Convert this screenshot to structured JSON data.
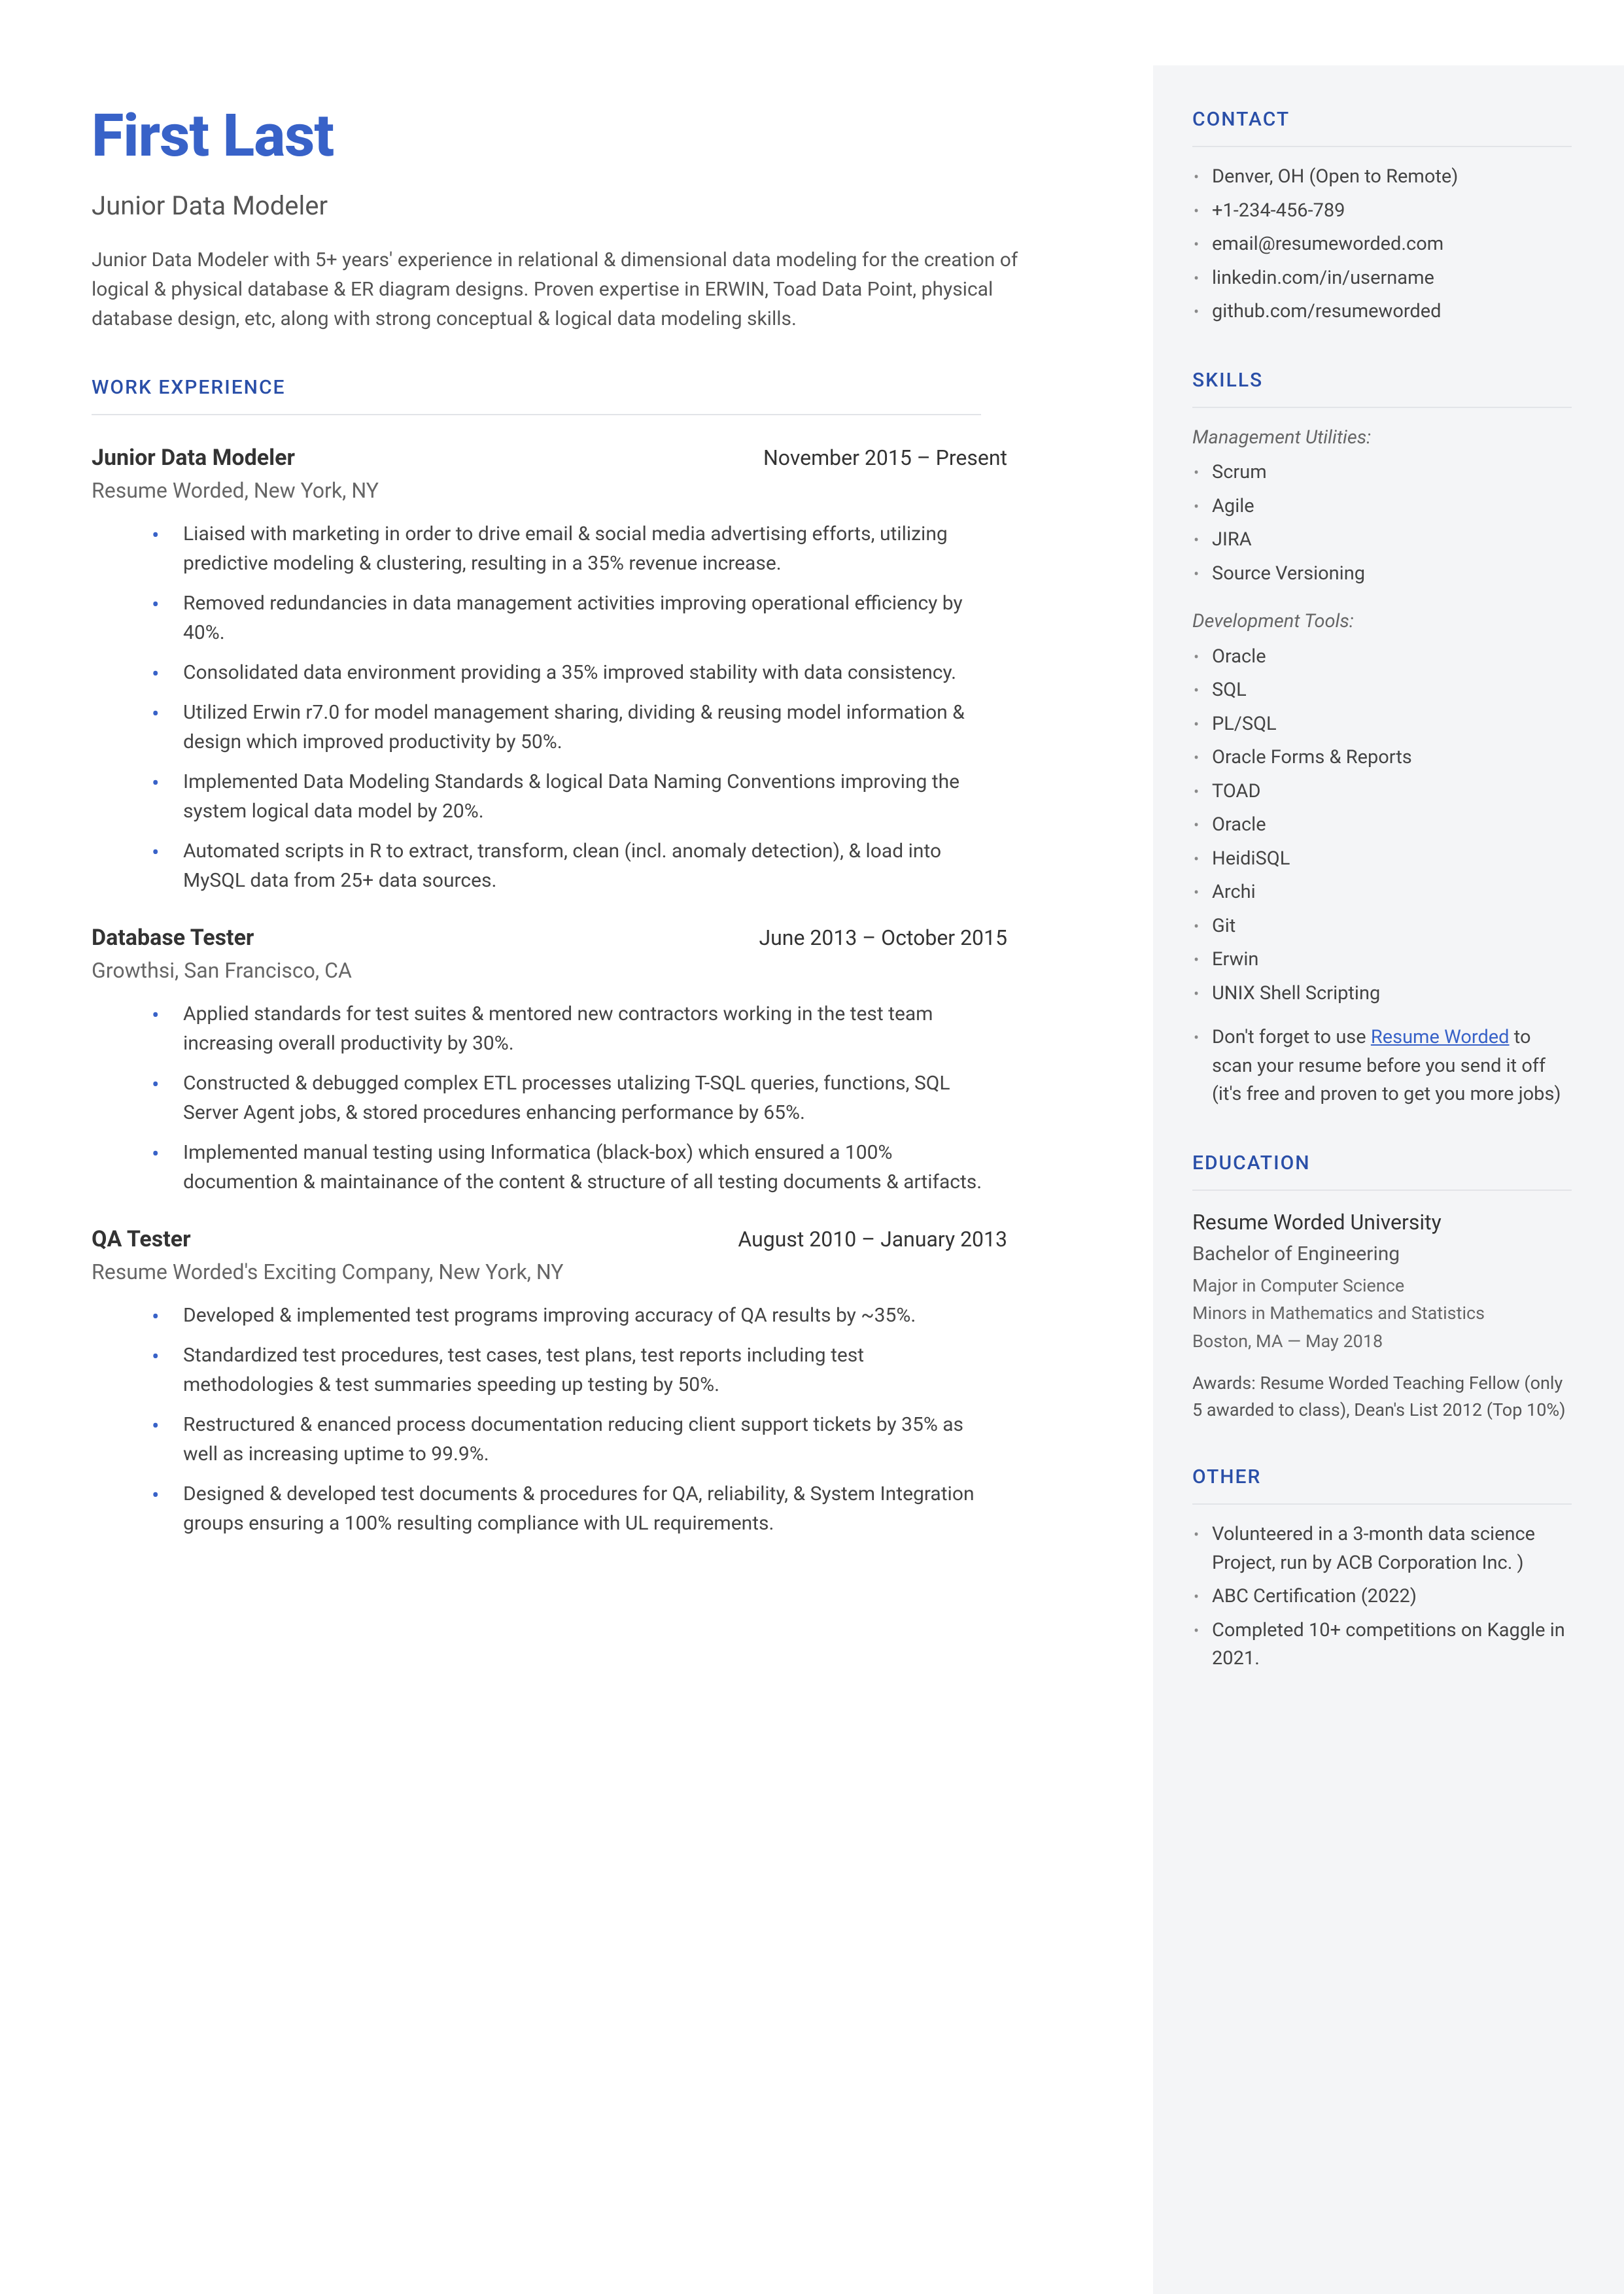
{
  "header": {
    "name": "First Last",
    "title": "Junior Data Modeler",
    "summary": "Junior Data Modeler with 5+ years' experience in relational & dimensional data modeling for the creation of logical & physical database & ER diagram designs. Proven expertise in ERWIN, Toad Data Point, physical database design, etc, along with strong conceptual & logical data modeling skills."
  },
  "sections": {
    "work_experience_heading": "WORK EXPERIENCE",
    "contact_heading": "CONTACT",
    "skills_heading": "SKILLS",
    "education_heading": "EDUCATION",
    "other_heading": "OTHER"
  },
  "work": [
    {
      "title": "Junior Data Modeler",
      "dates": "November 2015 – Present",
      "company": "Resume Worded, New York, NY",
      "bullets": [
        "Liaised with marketing in order to drive email & social media advertising efforts, utilizing predictive modeling & clustering, resulting in a 35% revenue increase.",
        "Removed redundancies in data management activities improving operational efficiency by 40%.",
        "Consolidated data environment providing a 35% improved stability with data consistency.",
        "Utilized Erwin r7.0 for model management sharing, dividing & reusing model information & design which improved productivity by 50%.",
        "Implemented Data Modeling Standards & logical Data Naming Conventions improving the system logical data model by 20%.",
        "Automated scripts in R to extract, transform, clean (incl. anomaly detection), & load into MySQL data from 25+ data sources."
      ]
    },
    {
      "title": "Database Tester",
      "dates": "June 2013 – October 2015",
      "company": "Growthsi, San Francisco, CA",
      "bullets": [
        "Applied standards for test suites & mentored new contractors working in the test team increasing overall productivity by 30%.",
        "Constructed & debugged complex ETL processes utalizing T-SQL queries, functions, SQL Server Agent jobs, & stored procedures enhancing performance by 65%.",
        "Implemented manual testing using Informatica (black-box) which ensured a 100% documention & maintainance of the content & structure of all testing documents & artifacts."
      ]
    },
    {
      "title": "QA Tester",
      "dates": "August 2010 – January 2013",
      "company": "Resume Worded's Exciting Company, New York, NY",
      "bullets": [
        "Developed & implemented test programs improving accuracy of QA results by ~35%.",
        "Standardized test procedures, test cases, test plans, test reports including test methodologies & test summaries speeding up testing by 50%.",
        "Restructured & enanced process documentation reducing client support tickets by 35% as well as increasing uptime to 99.9%.",
        "Designed & developed test documents & procedures for QA, reliability, & System Integration groups ensuring a 100% resulting compliance with UL requirements."
      ]
    }
  ],
  "contact": [
    "Denver, OH (Open to Remote)",
    "+1-234-456-789",
    "email@resumeworded.com",
    "linkedin.com/in/username",
    "github.com/resumeworded"
  ],
  "skills": {
    "groups": [
      {
        "title": "Management Utilities:",
        "items": [
          "Scrum",
          "Agile",
          "JIRA",
          "Source Versioning"
        ]
      },
      {
        "title": "Development Tools:",
        "items": [
          "Oracle",
          "SQL",
          "PL/SQL",
          "Oracle Forms & Reports",
          "TOAD",
          "Oracle",
          "HeidiSQL",
          "Archi",
          "Git",
          "Erwin",
          "UNIX Shell Scripting"
        ]
      }
    ],
    "note_prefix": "Don't forget to use ",
    "note_link": "Resume Worded",
    "note_suffix": " to scan your resume before you send it off (it's free and proven to get you more jobs)"
  },
  "education": {
    "school": "Resume Worded University",
    "degree": "Bachelor of Engineering",
    "major": "Major in Computer Science",
    "minors": "Minors in Mathematics and Statistics",
    "location": "Boston, MA — May 2018",
    "awards": "Awards: Resume Worded Teaching Fellow (only 5 awarded to class), Dean's List 2012 (Top 10%)"
  },
  "other": [
    "Volunteered in a 3-month data science Project, run by ACB Corporation Inc. )",
    "ABC Certification (2022)",
    "Completed 10+ competitions on Kaggle in 2021."
  ]
}
